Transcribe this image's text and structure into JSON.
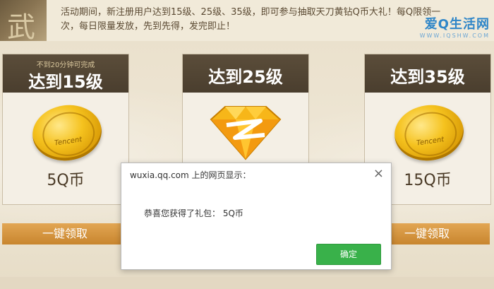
{
  "notice": {
    "text": "活动期间，新注册用户达到15级、25级、35级，即可参与抽取天刀黄钻Q币大礼！每Q限领一次，每日限量发放，先到先得，发完即止！"
  },
  "brand": {
    "name": "爱Q生活网",
    "url": "WWW.IQSHW.COM"
  },
  "cards": [
    {
      "subtitle": "不到20分钟可完成",
      "title": "达到15级",
      "reward": "5Q币",
      "icon": "gold-coin-icon",
      "button": "一键领取"
    },
    {
      "subtitle": "",
      "title": "达到25级",
      "reward": "",
      "icon": "yellow-diamond-icon",
      "button": ""
    },
    {
      "subtitle": "",
      "title": "达到35级",
      "reward": "15Q币",
      "icon": "gold-coin-icon",
      "button": "一键领取"
    }
  ],
  "coin_text": "Tencent",
  "dialog": {
    "title": "wuxia.qq.com 上的网页显示：",
    "message": "恭喜您获得了礼包： 5Q币",
    "ok_label": "确定",
    "close_icon": "close-icon"
  },
  "colors": {
    "header_dark": "#4a3e2e",
    "claim_button": "#d6974a",
    "ok_button": "#39b14a",
    "brand_blue": "#2f86c8"
  }
}
